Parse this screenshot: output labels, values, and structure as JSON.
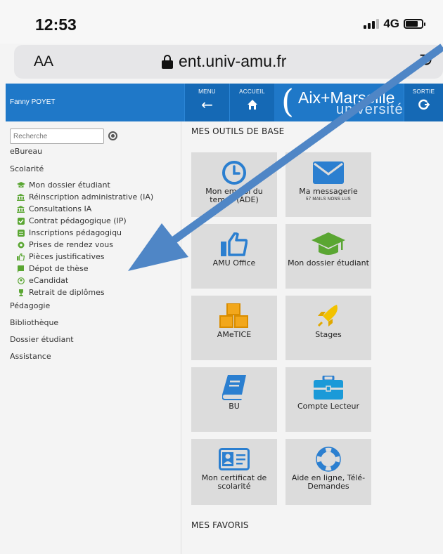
{
  "status_bar": {
    "time": "12:53",
    "network": "4G"
  },
  "browser": {
    "text_size_label": "AA",
    "url": "ent.univ-amu.fr"
  },
  "header": {
    "user_name": "Fanny POYET",
    "menu_label": "MENU",
    "home_label": "ACCUEIL",
    "logo_line1": "Aix+Marseille",
    "logo_line2": "université",
    "exit_label": "SORTIE"
  },
  "sidebar": {
    "search_placeholder": "Recherche",
    "categories": {
      "ebureau": "eBureau",
      "scolarite": "Scolarité",
      "pedagogie": "Pédagogie",
      "bibliotheque": "Bibliothèque",
      "dossier": "Dossier étudiant",
      "assistance": "Assistance"
    },
    "scolarite_items": [
      {
        "label": "Mon dossier étudiant",
        "icon": "graduation-cap-icon"
      },
      {
        "label": "Réinscription administrative (IA)",
        "icon": "institution-icon"
      },
      {
        "label": "Consultations IA",
        "icon": "institution-icon"
      },
      {
        "label": "Contrat pédagogique (IP)",
        "icon": "check-square-icon"
      },
      {
        "label": "Inscriptions pédagogiqu",
        "icon": "list-icon"
      },
      {
        "label": "Prises de rendez vous",
        "icon": "circle-icon"
      },
      {
        "label": "Pièces justificatives",
        "icon": "thumbs-up-icon"
      },
      {
        "label": "Dépot de thèse",
        "icon": "book-icon"
      },
      {
        "label": "eCandidat",
        "icon": "user-circle-icon"
      },
      {
        "label": "Retrait de diplômes",
        "icon": "trophy-icon"
      }
    ]
  },
  "main": {
    "section_title": "MES OUTILS DE BASE",
    "favorites_title": "MES FAVORIS",
    "tiles": [
      {
        "label": "Mon emploi du temps (ADE)",
        "icon": "clock-icon"
      },
      {
        "label": "Ma messagerie",
        "sublabel": "57 MAILS NONS LUS",
        "icon": "envelope-icon"
      },
      {
        "label": "AMU Office",
        "icon": "thumbs-up-icon"
      },
      {
        "label": "Mon dossier étudiant",
        "icon": "graduation-cap-icon"
      },
      {
        "label": "AMeTICE",
        "icon": "cubes-icon"
      },
      {
        "label": "Stages",
        "icon": "rocket-icon"
      },
      {
        "label": "BU",
        "icon": "book-icon"
      },
      {
        "label": "Compte Lecteur",
        "icon": "briefcase-icon"
      },
      {
        "label": "Mon certificat de scolarité",
        "icon": "id-card-icon"
      },
      {
        "label": "Aide en ligne, Télé-Demandes",
        "icon": "lifebuoy-icon"
      }
    ]
  },
  "colors": {
    "header_blue": "#1f78c8",
    "accent_blue": "#2b7fd0",
    "arrow_blue": "#4f86c6",
    "sidebar_green": "#5aa632",
    "tile_bg": "#dcdcdc"
  }
}
